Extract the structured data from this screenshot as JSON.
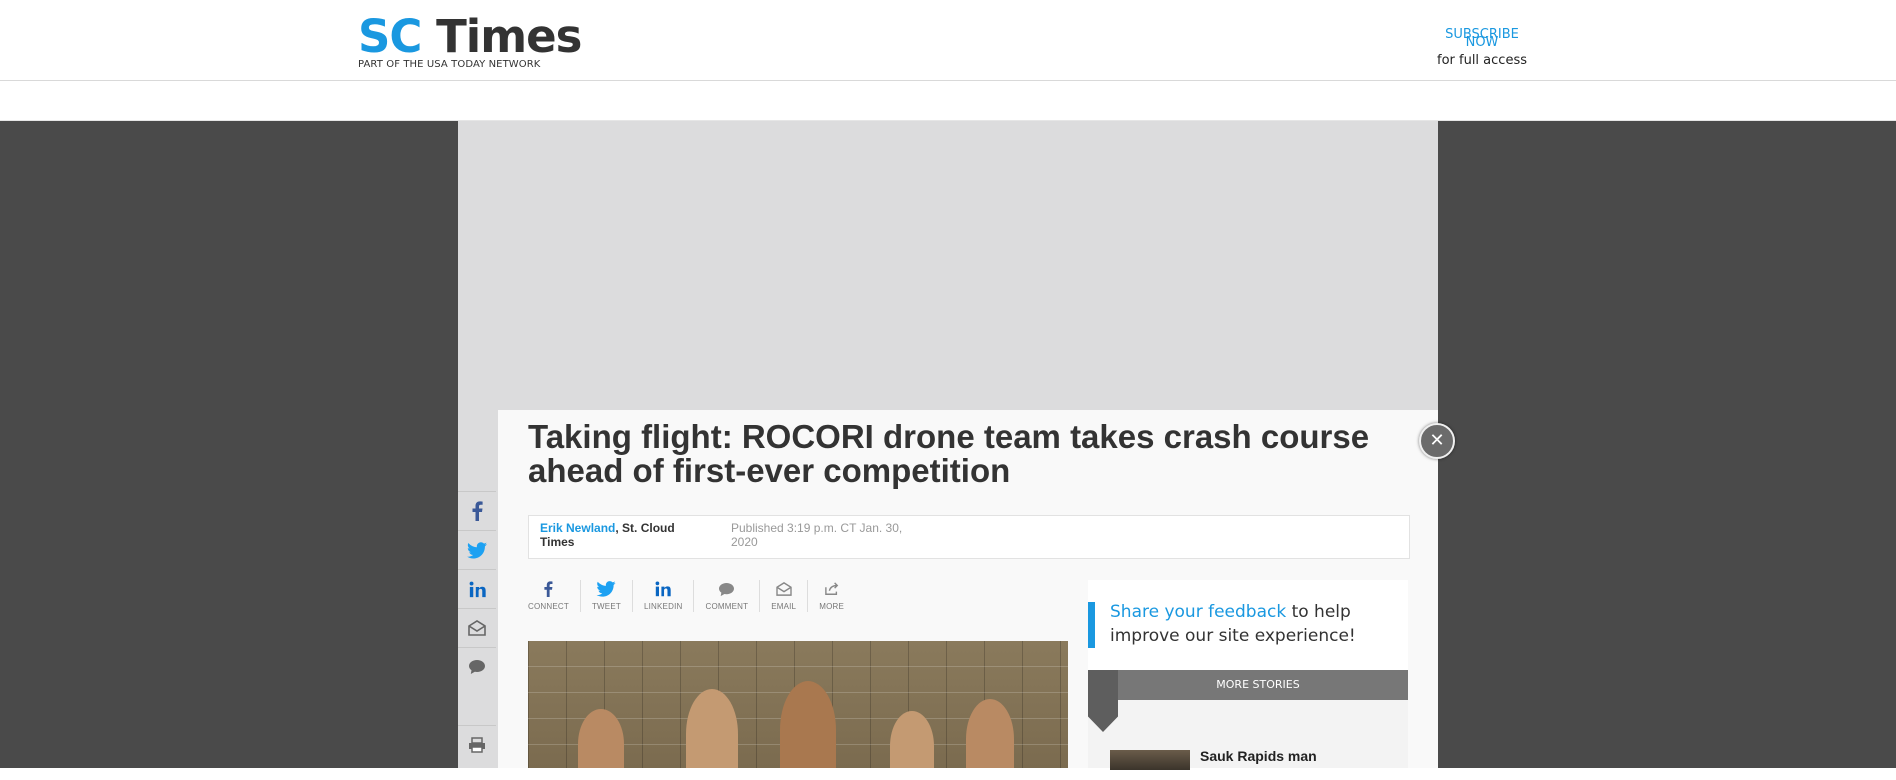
{
  "header": {
    "logo_sc": "SC",
    "logo_times": "Times",
    "tagline": "PART OF THE USA TODAY NETWORK",
    "subscribe_line1": "SUBSCRIBE",
    "subscribe_line2": "NOW",
    "subscribe_note": "for full access"
  },
  "article": {
    "headline": "Taking flight: ROCORI drone team takes crash course ahead of first-ever competition",
    "author_name": "Erik Newland",
    "author_outlet": ", St. Cloud Times",
    "published": "Published 3:19 p.m. CT Jan. 30, 2020"
  },
  "share_bar": [
    {
      "label": "CONNECT",
      "icon": "facebook-icon"
    },
    {
      "label": "TWEET",
      "icon": "twitter-icon"
    },
    {
      "label": "LINKEDIN",
      "icon": "linkedin-icon"
    },
    {
      "label": "COMMENT",
      "icon": "comment-icon"
    },
    {
      "label": "EMAIL",
      "icon": "email-icon"
    },
    {
      "label": "MORE",
      "icon": "share-icon"
    }
  ],
  "side_rail": [
    "facebook-icon",
    "twitter-icon",
    "linkedin-icon",
    "email-icon",
    "comment-icon",
    "print-icon"
  ],
  "feedback": {
    "link_text": "Share your feedback",
    "rest_text": " to help improve our site experience!"
  },
  "more_stories": {
    "heading": "MORE STORIES",
    "first_title": "Sauk Rapids man"
  },
  "colors": {
    "brand_blue": "#1a98e0",
    "backdrop": "#4a4a4a",
    "ad_zone": "#dcdcdd"
  }
}
